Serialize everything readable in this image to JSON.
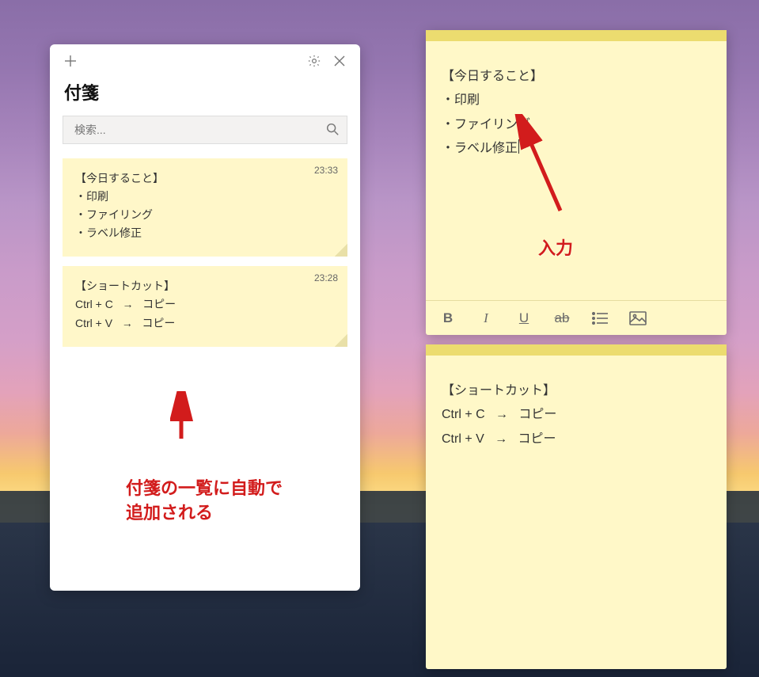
{
  "list_window": {
    "heading": "付箋",
    "search_placeholder": "検索...",
    "notes": [
      {
        "time": "23:33",
        "lines": [
          "【今日すること】",
          "・印刷",
          "・ファイリング",
          "・ラベル修正"
        ]
      },
      {
        "time": "23:28",
        "lines": [
          "【ショートカット】",
          "Ctrl + C   →   コピー",
          "Ctrl + V   →   コピー"
        ]
      }
    ]
  },
  "top_sticky": {
    "lines": [
      "【今日すること】",
      "・印刷",
      "・ファイリング",
      "・ラベル修正"
    ],
    "show_caret": true
  },
  "bottom_sticky": {
    "lines": [
      "【ショートカット】",
      "Ctrl + C   →   コピー",
      "Ctrl + V   →   コピー"
    ]
  },
  "annotations": {
    "input_label": "入力",
    "autoadd_line1": "付箋の一覧に自動で",
    "autoadd_line2": "追加される"
  },
  "colors": {
    "sticky_bg": "#fff8c8",
    "sticky_bar": "#ecdc6f",
    "annotation_red": "#d21c1c"
  }
}
